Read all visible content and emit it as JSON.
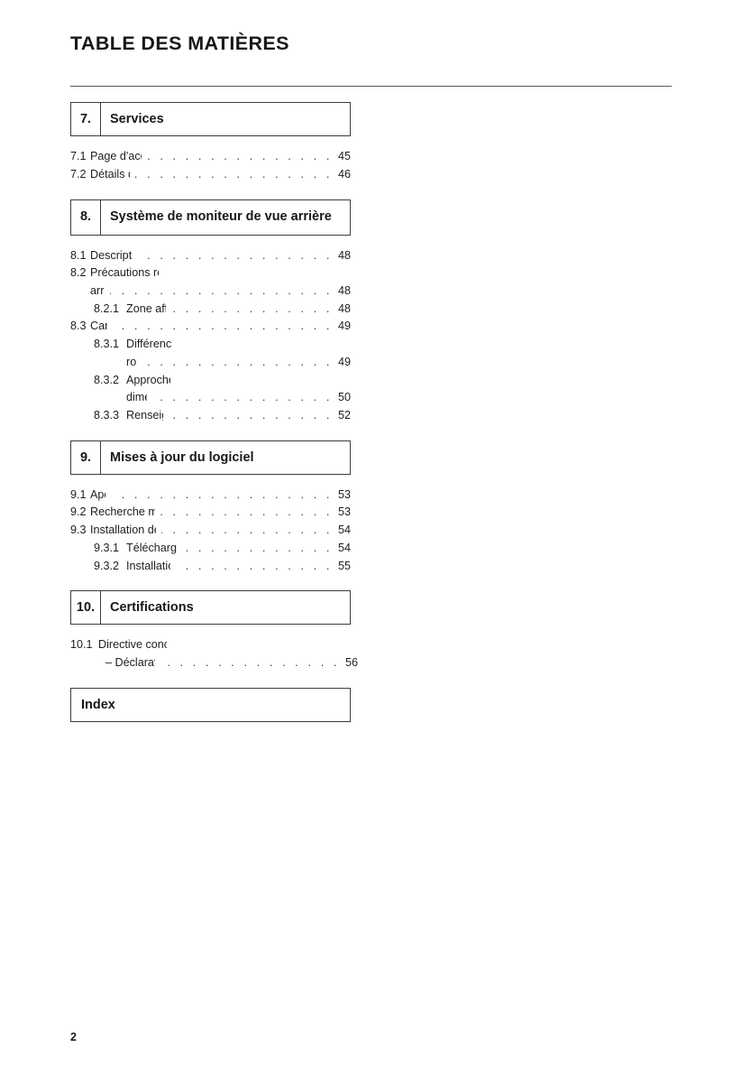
{
  "document": {
    "title": "TABLE DES MATIÈRES",
    "page_number": "2"
  },
  "sections": [
    {
      "number": "7.",
      "title": "Services",
      "entries": [
        {
          "num": "7.1",
          "lines": [
            {
              "text": "Page d'accueil des services",
              "page": "45"
            }
          ]
        },
        {
          "num": "7.2",
          "lines": [
            {
              "text": "Détails des services",
              "page": "46"
            }
          ]
        }
      ]
    },
    {
      "number": "8.",
      "title": "Système de moniteur de vue arrière",
      "entries": [
        {
          "num": "8.1",
          "lines": [
            {
              "text": "Description de l'écran",
              "page": "48"
            }
          ]
        },
        {
          "num": "8.2",
          "lines": [
            {
              "text": "Précautions relatives au moniteur de vue",
              "page": ""
            },
            {
              "text": "arrière",
              "page": "48"
            }
          ]
        },
        {
          "num": "8.2.1",
          "level": 2,
          "lines": [
            {
              "text": "Zone affichée sur l'écran",
              "page": "48"
            }
          ]
        },
        {
          "num": "8.3",
          "lines": [
            {
              "text": "Caméra",
              "page": "49"
            }
          ]
        },
        {
          "num": "8.3.1",
          "level": 2,
          "lines": [
            {
              "text": "Différences entre l'écran et la",
              "page": ""
            },
            {
              "text": "route",
              "page": "49"
            }
          ]
        },
        {
          "num": "8.3.2",
          "level": 2,
          "lines": [
            {
              "text": "Approche des objets en trois",
              "page": ""
            },
            {
              "text": "dimensions",
              "page": "50"
            }
          ]
        },
        {
          "num": "8.3.3",
          "level": 2,
          "lines": [
            {
              "text": "Renseignements utiles",
              "page": "52"
            }
          ]
        }
      ]
    },
    {
      "number": "9.",
      "title": "Mises à jour du logiciel",
      "entries": [
        {
          "num": "9.1",
          "lines": [
            {
              "text": "Aperçu",
              "page": "53"
            }
          ]
        },
        {
          "num": "9.2",
          "lines": [
            {
              "text": "Recherche manuelle des mises à jour",
              "page": "53"
            }
          ]
        },
        {
          "num": "9.3",
          "lines": [
            {
              "text": "Installation de la mise à jour du logiciel",
              "page": "54"
            }
          ]
        },
        {
          "num": "9.3.1",
          "level": 2,
          "lines": [
            {
              "text": "Téléchargement de la mise à jour",
              "page": "54"
            }
          ]
        },
        {
          "num": "9.3.2",
          "level": 2,
          "lines": [
            {
              "text": "Installation de la mise à jour",
              "page": "55"
            }
          ]
        }
      ]
    },
    {
      "number": "10.",
      "title": "Certifications",
      "entries": [
        {
          "num": "10.1",
          "wide": true,
          "lines": [
            {
              "text": "Directive concernant les équipements radio",
              "page": ""
            },
            {
              "text": "– Déclaration de conformité",
              "page": "56",
              "indent": true
            }
          ]
        }
      ]
    },
    {
      "number": "",
      "title": "Index",
      "entries": []
    }
  ]
}
